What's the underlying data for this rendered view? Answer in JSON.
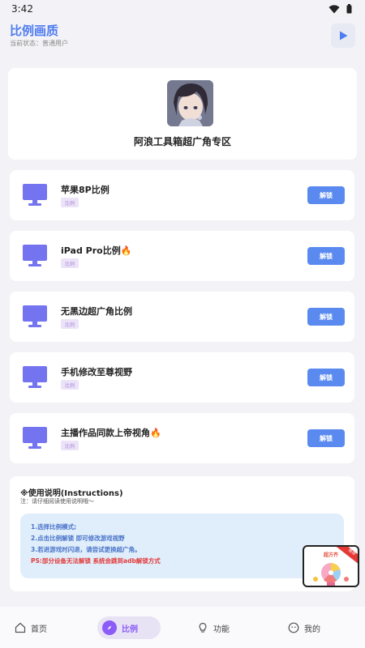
{
  "status_bar": {
    "time": "3:42"
  },
  "app_bar": {
    "title": "比例画质",
    "subtitle": "当前状态：普通用户"
  },
  "header": {
    "title": "阿浪工具箱超广角专区"
  },
  "items": [
    {
      "title": "苹果8P比例",
      "tag": "比例",
      "button": "解锁"
    },
    {
      "title": "iPad Pro比例🔥",
      "tag": "比例",
      "button": "解锁"
    },
    {
      "title": "无黑边超广角比例",
      "tag": "比例",
      "button": "解锁"
    },
    {
      "title": "手机修改至尊视野",
      "tag": "比例",
      "button": "解锁"
    },
    {
      "title": "主播作品同款上帝视角🔥",
      "tag": "比例",
      "button": "解锁"
    }
  ],
  "instructions": {
    "title": "※使用说明(Instructions)",
    "note": "注：请仔细阅读使用说明哦～",
    "lines": [
      "1.选择比例模式;",
      "2.点击比例解锁 即可修改游戏视野",
      "3.若进游戏时闪退，请尝试更换超广角。"
    ],
    "warning": "PS:部分设备无法解锁 系统会跳到adb解锁方式"
  },
  "promo": {
    "label": "超方齐",
    "corner": "推荐"
  },
  "nav": {
    "home": "首页",
    "ratio": "比例",
    "function": "功能",
    "mine": "我的"
  },
  "colors": {
    "accent": "#5a8aef",
    "purple": "#8b5cf6",
    "monitor": "#7473f0"
  }
}
